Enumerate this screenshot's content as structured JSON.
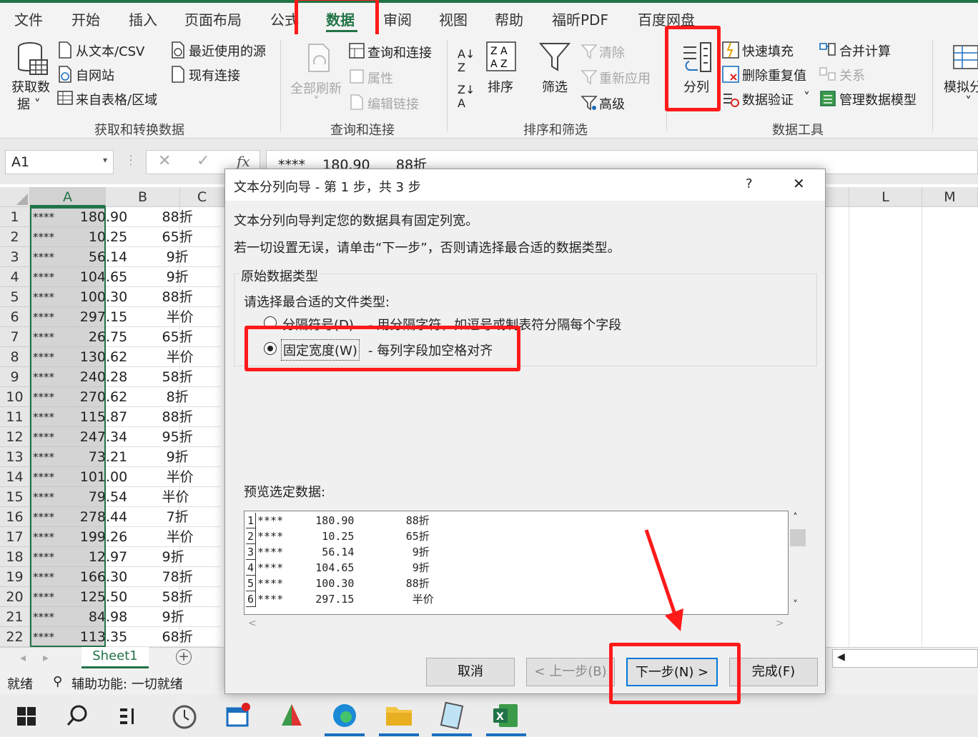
{
  "tabs": [
    "文件",
    "开始",
    "插入",
    "页面布局",
    "公式",
    "数据",
    "审阅",
    "视图",
    "帮助",
    "福昕PDF",
    "百度网盘"
  ],
  "active_tab": "数据",
  "ribbon": {
    "get_data": "获取数",
    "get_data2": "据 ˅",
    "from_text": "从文本/CSV",
    "from_web": "自网站",
    "from_table": "来自表格/区域",
    "recent_sources": "最近使用的源",
    "existing_conn": "现有连接",
    "group_get": "获取和转换数据",
    "refresh_all": "全部刷新",
    "queries_conn": "查询和连接",
    "properties": "属性",
    "edit_links": "编辑链接",
    "group_query": "查询和连接",
    "sort": "排序",
    "filter": "筛选",
    "clear": "清除",
    "reapply": "重新应用",
    "advanced": "高级",
    "group_sort": "排序和筛选",
    "text_to_columns": "分列",
    "flash_fill": "快速填充",
    "remove_dup": "删除重复值",
    "data_validation": "数据验证",
    "consolidate": "合并计算",
    "relationships": "关系",
    "manage_model": "管理数据模型",
    "group_tools": "数据工具",
    "whatif": "模拟分"
  },
  "formula_bar": {
    "name_box": "A1",
    "fx": "fx",
    "content": "****    180.90      88折"
  },
  "columns": [
    "A",
    "B",
    "C",
    "L",
    "M"
  ],
  "rows": [
    {
      "n": "1",
      "a1": "****",
      "a2": "180",
      "b": ".90        88折"
    },
    {
      "n": "2",
      "a1": "****",
      "a2": "10",
      "b": ".25        65折"
    },
    {
      "n": "3",
      "a1": "****",
      "a2": "56",
      "b": ".14         9折"
    },
    {
      "n": "4",
      "a1": "****",
      "a2": "104",
      "b": ".65         9折"
    },
    {
      "n": "5",
      "a1": "****",
      "a2": "100",
      "b": ".30        88折"
    },
    {
      "n": "6",
      "a1": "****",
      "a2": "297",
      "b": ".15         半价"
    },
    {
      "n": "7",
      "a1": "****",
      "a2": "26",
      "b": ".75        65折"
    },
    {
      "n": "8",
      "a1": "****",
      "a2": "130",
      "b": ".62         半价"
    },
    {
      "n": "9",
      "a1": "****",
      "a2": "240",
      "b": ".28        58折"
    },
    {
      "n": "10",
      "a1": "****",
      "a2": "270",
      "b": ".62         8折"
    },
    {
      "n": "11",
      "a1": "****",
      "a2": "115",
      "b": ".87        88折"
    },
    {
      "n": "12",
      "a1": "****",
      "a2": "247",
      "b": ".34        95折"
    },
    {
      "n": "13",
      "a1": "****",
      "a2": "73",
      "b": ".21         9折"
    },
    {
      "n": "14",
      "a1": "****",
      "a2": "101",
      "b": ".00         半价"
    },
    {
      "n": "15",
      "a1": "****",
      "a2": "79",
      "b": ".54        半价"
    },
    {
      "n": "16",
      "a1": "****",
      "a2": "278",
      "b": ".44         7折"
    },
    {
      "n": "17",
      "a1": "****",
      "a2": "199",
      "b": ".26         半价"
    },
    {
      "n": "18",
      "a1": "****",
      "a2": "12",
      "b": ".97        9折"
    },
    {
      "n": "19",
      "a1": "****",
      "a2": "166",
      "b": ".30        78折"
    },
    {
      "n": "20",
      "a1": "****",
      "a2": "125",
      "b": ".50        58折"
    },
    {
      "n": "21",
      "a1": "****",
      "a2": "84",
      "b": ".98        9折"
    },
    {
      "n": "22",
      "a1": "****",
      "a2": "113",
      "b": ".35        68折"
    }
  ],
  "sheet_tab": "Sheet1",
  "status": {
    "ready": "就绪",
    "accessibility": "辅助功能: 一切就绪"
  },
  "dialog": {
    "title": "文本分列向导 - 第 1 步，共 3 步",
    "help": "?",
    "close": "✕",
    "line1": "文本分列向导判定您的数据具有固定列宽。",
    "line2": "若一切设置无误，请单击“下一步”，否则请选择最合适的数据类型。",
    "group_label": "原始数据类型",
    "choose_label": "请选择最合适的文件类型:",
    "opt_delim": "分隔符号(D)",
    "opt_delim_desc": "- 用分隔字符，如逗号或制表符分隔每个字段",
    "opt_fixed": "固定宽度(W)",
    "opt_fixed_desc": "- 每列字段加空格对齐",
    "preview_label": "预览选定数据:",
    "preview_rows": [
      {
        "n": "1",
        "t": "****     180.90        88折"
      },
      {
        "n": "2",
        "t": "****      10.25        65折"
      },
      {
        "n": "3",
        "t": "****      56.14         9折"
      },
      {
        "n": "4",
        "t": "****     104.65         9折"
      },
      {
        "n": "5",
        "t": "****     100.30        88折"
      },
      {
        "n": "6",
        "t": "****     297.15         半价"
      }
    ],
    "btn_cancel": "取消",
    "btn_back": "< 上一步(B)",
    "btn_next": "下一步(N) >",
    "btn_finish": "完成(F)"
  },
  "colors": {
    "excel_green": "#217346",
    "highlight_red": "#ff1a1a",
    "selection_blue": "#0078d7"
  }
}
